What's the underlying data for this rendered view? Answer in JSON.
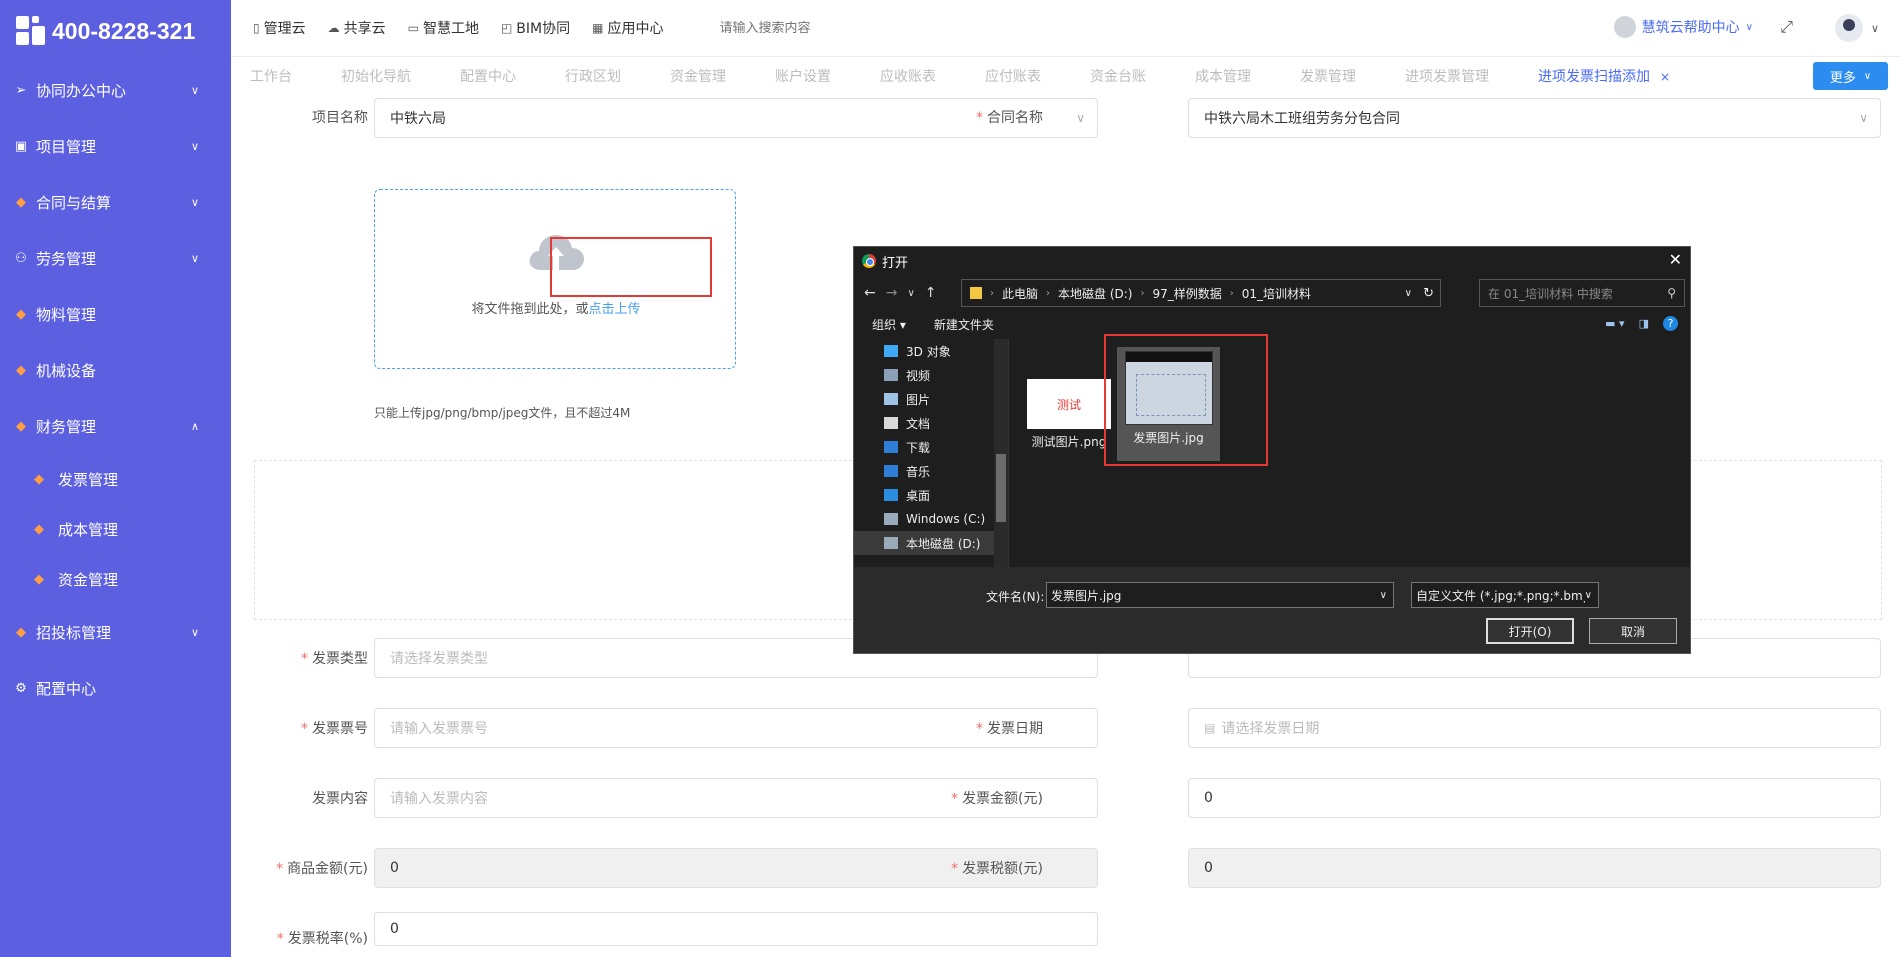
{
  "brand": {
    "phone": "400-8228-321"
  },
  "sidebar": {
    "items": [
      {
        "label": "协同办公中心",
        "icon": "send-icon",
        "chevron": "⌄"
      },
      {
        "label": "项目管理",
        "icon": "book-icon",
        "chevron": "⌄"
      },
      {
        "label": "合同与结算",
        "icon": "gem-icon",
        "chevron": "⌄"
      },
      {
        "label": "劳务管理",
        "icon": "people-icon",
        "chevron": "⌄"
      },
      {
        "label": "物料管理",
        "icon": "gem-icon"
      },
      {
        "label": "机械设备",
        "icon": "gem-icon"
      },
      {
        "label": "财务管理",
        "icon": "gem-icon",
        "chevron": "⌃"
      }
    ],
    "sub_items": [
      {
        "label": "发票管理",
        "icon": "gem-icon"
      },
      {
        "label": "成本管理",
        "icon": "gem-icon"
      },
      {
        "label": "资金管理",
        "icon": "gem-icon"
      }
    ],
    "bottom_items": [
      {
        "label": "招投标管理",
        "icon": "gem-icon",
        "chevron": "⌄"
      },
      {
        "label": "配置中心",
        "icon": "gear-icon"
      }
    ]
  },
  "header": {
    "links": [
      "管理云",
      "共享云",
      "智慧工地",
      "BIM协同",
      "应用中心"
    ],
    "search_placeholder": "请输入搜索内容",
    "help_label": "慧筑云帮助中心"
  },
  "tabs": {
    "items": [
      "工作台",
      "初始化导航",
      "配置中心",
      "行政区划",
      "资金管理",
      "账户设置",
      "应收账表",
      "应付账表",
      "资金台账",
      "成本管理",
      "发票管理",
      "进项发票管理"
    ],
    "active": "进项发票扫描添加",
    "more_label": "更多"
  },
  "form": {
    "project_label": "项目名称",
    "project_value": "中铁六局",
    "contract_label": "合同名称",
    "contract_value": "中铁六局木工班组劳务分包合同",
    "upload_text": "将文件拖到此处，或",
    "upload_link": "点击上传",
    "upload_hint": "只能上传jpg/png/bmp/jpeg文件，且不超过4M",
    "invoice_type_label": "发票类型",
    "invoice_type_placeholder": "请选择发票类型",
    "invoice_no_label": "发票票号",
    "invoice_no_placeholder": "请输入发票票号",
    "invoice_date_label": "发票日期",
    "invoice_date_placeholder": "请选择发票日期",
    "invoice_content_label": "发票内容",
    "invoice_content_placeholder": "请输入发票内容",
    "invoice_amount_label": "发票金额(元)",
    "invoice_amount_value": "0",
    "goods_amount_label": "商品金额(元)",
    "goods_amount_value": "0",
    "tax_amount_label": "发票税额(元)",
    "tax_amount_value": "0",
    "tax_rate_label": "发票税率(%)",
    "tax_rate_value": "0"
  },
  "dialog": {
    "title": "打开",
    "breadcrumb": [
      "此电脑",
      "本地磁盘 (D:)",
      "97_样例数据",
      "01_培训材料"
    ],
    "search_placeholder": "在 01_培训材料 中搜索",
    "organize_label": "组织 ▾",
    "new_folder_label": "新建文件夹",
    "tree": [
      "3D 对象",
      "视频",
      "图片",
      "文档",
      "下载",
      "音乐",
      "桌面",
      "Windows (C:)",
      "本地磁盘 (D:)"
    ],
    "files": [
      {
        "name": "测试图片.png",
        "thumb_text": "测试"
      },
      {
        "name": "发票图片.jpg"
      }
    ],
    "filename_label": "文件名(N):",
    "filename_value": "发票图片.jpg",
    "filetype_value": "自定义文件 (*.jpg;*.png;*.bmp",
    "open_label": "打开(O)",
    "cancel_label": "取消"
  }
}
